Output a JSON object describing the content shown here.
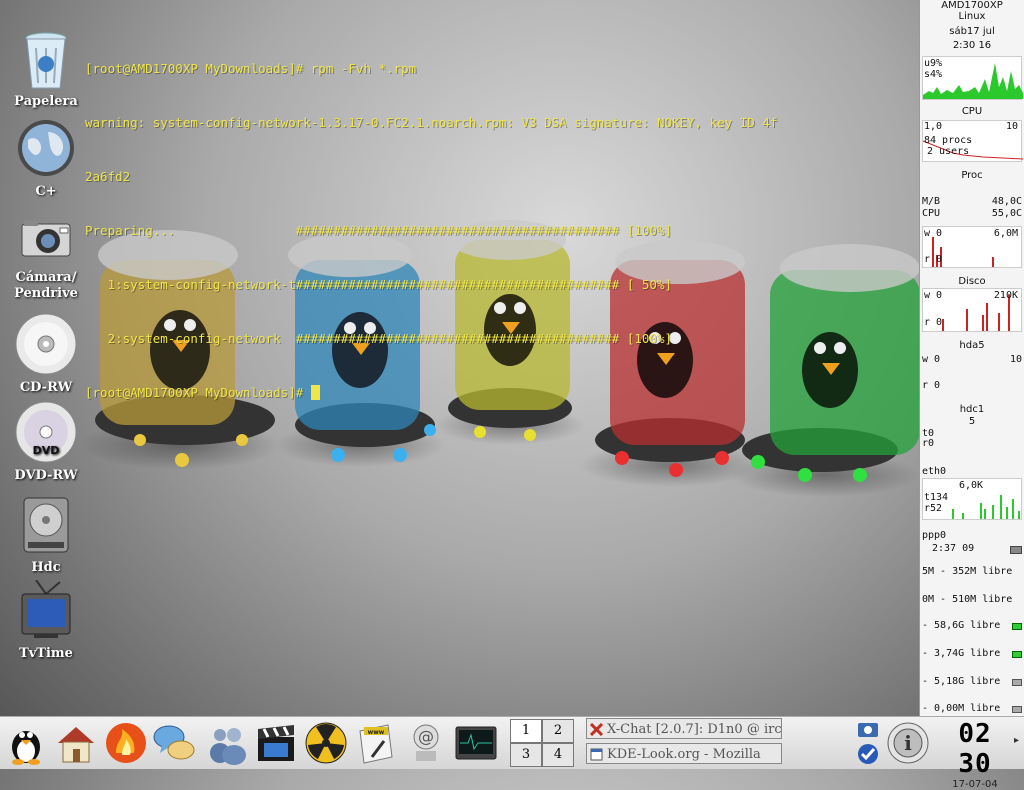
{
  "desktop_icons": [
    {
      "label": "Papelera",
      "icon": "trash-icon"
    },
    {
      "label": "C+",
      "icon": "globe-drive-icon"
    },
    {
      "label": "Cámara/\nPendrive",
      "icon": "camera-icon"
    },
    {
      "label": "CD-RW",
      "icon": "cd-icon"
    },
    {
      "label": "DVD-RW",
      "icon": "dvd-icon"
    },
    {
      "label": "Hdc",
      "icon": "hard-drive-icon"
    },
    {
      "label": "TvTime",
      "icon": "tv-icon"
    }
  ],
  "terminal": {
    "lines": [
      "[root@AMD1700XP MyDownloads]# rpm -Fvh *.rpm",
      "warning: system-config-network-1.3.17-0.FC2.1.noarch.rpm: V3 DSA signature: NOKEY, key ID 4f",
      "2a6fd2",
      "Preparing...                ########################################### [100%]",
      "   1:system-config-network-t########################################### [ 50%]",
      "   2:system-config-network  ########################################### [100%]"
    ],
    "prompt": "[root@AMD1700XP MyDownloads]# ",
    "color": "#f0e64a"
  },
  "monitor": {
    "host": "AMD1700XP",
    "os": "Linux",
    "date": "sáb17 jul",
    "time": "2:30 16",
    "cpu_u": "u9%",
    "cpu_s": "s4%",
    "cpu_title": "CPU",
    "load": "1,0",
    "load_max": "10",
    "procs": "84 procs",
    "users": "2 users",
    "proc_title": "Proc",
    "mb_label": "M/B",
    "mb_temp": "48,0C",
    "cpu_label": "CPU",
    "cpu_temp": "55,0C",
    "w0_a": "w 0",
    "w0_a_val": "6,0M",
    "r0_a": "r 0",
    "disk_title": "Disco",
    "w0_b": "w 0",
    "w0_b_val": "210K",
    "r0_b": "r 0",
    "hda5_title": "hda5",
    "w0_c": "w 0",
    "w0_c_val": "10",
    "r0_c": "r 0",
    "hdc1_title": "hdc1",
    "hdc1_val": "5",
    "t0": "t0",
    "r0_d": "r0",
    "eth0_title": "eth0",
    "eth0_val": "6,0K",
    "t134": "t134",
    "r52": "r52",
    "ppp0_title": "ppp0",
    "ppp0_time": "2:37 09",
    "mem": [
      {
        "text": "5M - 352M libre",
        "bar": "green"
      },
      {
        "text": "0M - 510M libre",
        "bar": "none"
      },
      {
        "text": "- 58,6G libre",
        "bar": "green"
      },
      {
        "text": "- 3,74G libre",
        "bar": "green"
      },
      {
        "text": "- 5,18G libre",
        "bar": "gray"
      },
      {
        "text": "- 0,00M libre",
        "bar": "gray"
      }
    ]
  },
  "taskbar": {
    "launchers": [
      "tux-menu-icon",
      "home-icon",
      "konqueror-fire-icon",
      "chat-bubbles-icon",
      "users-icon",
      "video-clapper-icon",
      "radiation-icon",
      "www-editor-icon",
      "mail-at-icon",
      "terminal-monitor-icon"
    ],
    "desktops": [
      "1",
      "2",
      "3",
      "4"
    ],
    "active_desktop": "1",
    "tasks": [
      {
        "title": "X-Chat [2.0.7]: D1n0 @ irc"
      },
      {
        "title": "KDE-Look.org - Mozilla"
      }
    ],
    "clock_time": "02 30",
    "clock_date": "17-07-04"
  }
}
